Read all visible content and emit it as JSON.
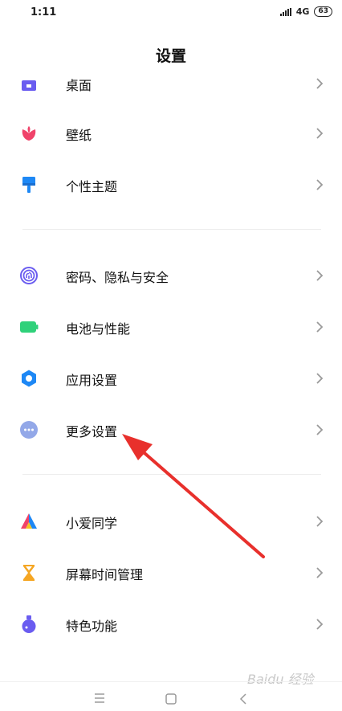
{
  "status_bar": {
    "time": "1:11",
    "network": "4G",
    "battery": "63"
  },
  "header": {
    "title": "设置"
  },
  "rows": [
    {
      "label": "桌面",
      "icon": "home-icon",
      "color": "#6a5cf0"
    },
    {
      "label": "壁纸",
      "icon": "flower-icon",
      "color": "#f0436a"
    },
    {
      "label": "个性主题",
      "icon": "brush-icon",
      "color": "#1e88f5"
    },
    {
      "label": "密码、隐私与安全",
      "icon": "fingerprint-icon",
      "color": "#6a5cf0"
    },
    {
      "label": "电池与性能",
      "icon": "battery-icon",
      "color": "#2fd17a"
    },
    {
      "label": "应用设置",
      "icon": "gear-icon",
      "color": "#1e88f5"
    },
    {
      "label": "更多设置",
      "icon": "more-icon",
      "color": "#93a8e8"
    },
    {
      "label": "小爱同学",
      "icon": "xiaoai-icon",
      "color": "#7a5cf0"
    },
    {
      "label": "屏幕时间管理",
      "icon": "hourglass-icon",
      "color": "#f5a623"
    },
    {
      "label": "特色功能",
      "icon": "flask-icon",
      "color": "#6a5cf0"
    }
  ],
  "watermark": "Baidu 经验",
  "annotation": {
    "arrow_color": "#e8302c"
  }
}
